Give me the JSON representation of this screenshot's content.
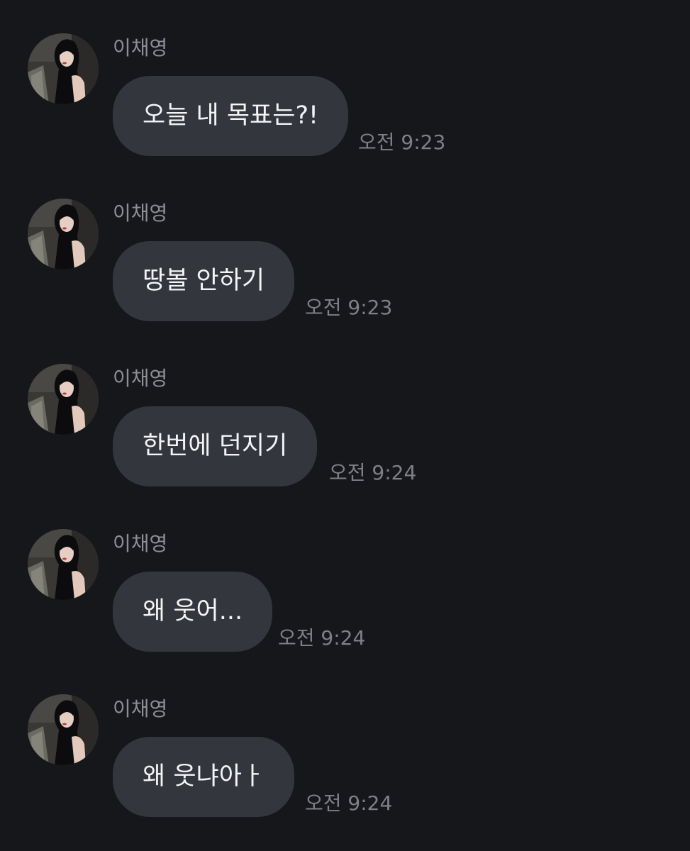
{
  "messages": [
    {
      "sender": "이채영",
      "text": "오늘 내 목표는?!",
      "time": "오전 9:23"
    },
    {
      "sender": "이채영",
      "text": "땅볼 안하기",
      "time": "오전 9:23"
    },
    {
      "sender": "이채영",
      "text": "한번에 던지기",
      "time": "오전 9:24"
    },
    {
      "sender": "이채영",
      "text": "왜 웃어...",
      "time": "오전 9:24"
    },
    {
      "sender": "이채영",
      "text": "왜 웃냐아ㅏ",
      "time": "오전 9:24"
    }
  ],
  "colors": {
    "background": "#16171b",
    "bubble": "#34363d",
    "bubble_text": "#f4f4f6",
    "sender_text": "#8e8f96",
    "time_text": "#7f8087"
  },
  "icons": {
    "avatar": "profile-photo"
  }
}
